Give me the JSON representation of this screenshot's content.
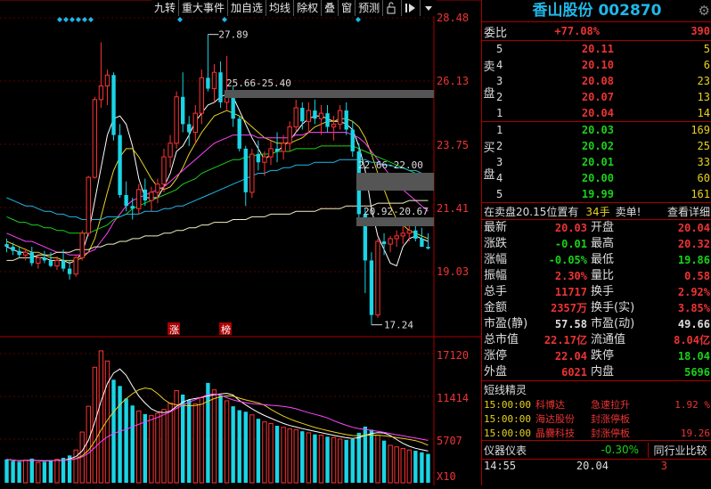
{
  "toolbar": [
    "九转",
    "重大事件",
    "加自选",
    "均线",
    "除权",
    "叠",
    "窗",
    "预测",
    "锁",
    "箭头",
    "下拉"
  ],
  "price_axis": [
    "28.48",
    "26.13",
    "23.75",
    "21.41",
    "19.03"
  ],
  "volume_axis": [
    "17120",
    "11414",
    "5707",
    "X10"
  ],
  "annotations": {
    "high": "27.89",
    "low": "17.24",
    "zone1": "25.66-25.40",
    "zone2": "22.66-22.00",
    "zone3": "20.92-20.67",
    "tag_zhang": "涨",
    "tag_bang": "榜"
  },
  "colors": {
    "up": "#ff3333",
    "down": "#19d5e6",
    "accent": "#1fb8e8",
    "volume_yellow": "#e8d21f",
    "green": "#19d219"
  },
  "chart_data": {
    "type": "candlestick",
    "ylim": [
      17.0,
      28.5
    ],
    "candles": [
      [
        20.2,
        20.4,
        19.9,
        20.1
      ],
      [
        20.1,
        20.25,
        19.8,
        19.95
      ],
      [
        19.95,
        20.1,
        19.7,
        19.8
      ],
      [
        19.8,
        20.05,
        19.6,
        19.9
      ],
      [
        19.9,
        20.1,
        19.4,
        19.5
      ],
      [
        19.5,
        19.8,
        19.3,
        19.7
      ],
      [
        19.7,
        19.95,
        19.5,
        19.6
      ],
      [
        19.6,
        19.9,
        19.35,
        19.4
      ],
      [
        19.4,
        19.75,
        19.25,
        19.6
      ],
      [
        19.6,
        20.0,
        19.2,
        19.3
      ],
      [
        19.3,
        19.6,
        18.9,
        19.1
      ],
      [
        19.1,
        19.8,
        19.0,
        19.7
      ],
      [
        19.7,
        20.7,
        19.6,
        20.6
      ],
      [
        20.6,
        22.7,
        20.5,
        22.65
      ],
      [
        22.65,
        25.6,
        22.6,
        25.5
      ],
      [
        25.5,
        27.6,
        25.2,
        26.0
      ],
      [
        26.0,
        26.6,
        25.3,
        26.4
      ],
      [
        26.4,
        26.5,
        24.0,
        24.2
      ],
      [
        24.2,
        24.6,
        21.9,
        22.0
      ],
      [
        22.0,
        22.5,
        21.4,
        21.6
      ],
      [
        21.6,
        21.9,
        21.1,
        21.5
      ],
      [
        21.5,
        22.4,
        21.3,
        22.2
      ],
      [
        22.2,
        22.6,
        21.6,
        21.8
      ],
      [
        21.8,
        22.3,
        21.4,
        22.1
      ],
      [
        22.1,
        22.6,
        21.7,
        22.4
      ],
      [
        22.4,
        23.7,
        22.1,
        23.4
      ],
      [
        23.4,
        24.2,
        23.0,
        23.9
      ],
      [
        23.9,
        25.8,
        23.7,
        25.6
      ],
      [
        25.6,
        26.5,
        24.3,
        24.6
      ],
      [
        24.6,
        24.9,
        23.8,
        24.3
      ],
      [
        24.3,
        25.3,
        23.9,
        25.0
      ],
      [
        25.0,
        26.6,
        24.6,
        26.3
      ],
      [
        26.3,
        27.89,
        25.8,
        25.9
      ],
      [
        25.9,
        26.8,
        25.4,
        26.5
      ],
      [
        26.5,
        26.9,
        25.2,
        25.4
      ],
      [
        25.4,
        27.1,
        25.1,
        25.8
      ],
      [
        25.8,
        26.0,
        24.5,
        24.8
      ],
      [
        24.8,
        24.9,
        23.6,
        23.7
      ],
      [
        23.7,
        23.8,
        21.6,
        22.1
      ],
      [
        22.1,
        23.7,
        21.9,
        23.5
      ],
      [
        23.5,
        24.0,
        22.9,
        23.2
      ],
      [
        23.2,
        23.6,
        22.7,
        23.4
      ],
      [
        23.4,
        24.0,
        23.1,
        23.7
      ],
      [
        23.7,
        24.3,
        23.2,
        23.6
      ],
      [
        23.6,
        24.2,
        23.3,
        23.9
      ],
      [
        23.9,
        24.7,
        23.6,
        24.5
      ],
      [
        24.5,
        25.5,
        24.3,
        25.2
      ],
      [
        25.2,
        25.4,
        24.4,
        24.7
      ],
      [
        24.7,
        25.4,
        24.3,
        25.1
      ],
      [
        25.1,
        25.5,
        24.6,
        24.8
      ],
      [
        24.8,
        25.3,
        24.2,
        25.0
      ],
      [
        25.0,
        25.3,
        24.3,
        24.5
      ],
      [
        24.5,
        24.9,
        24.0,
        24.6
      ],
      [
        24.6,
        25.3,
        24.4,
        25.1
      ],
      [
        25.1,
        25.4,
        24.2,
        24.4
      ],
      [
        24.4,
        24.7,
        23.4,
        23.6
      ],
      [
        23.6,
        23.9,
        21.1,
        21.3
      ],
      [
        21.3,
        21.5,
        18.4,
        19.6
      ],
      [
        19.6,
        19.9,
        17.24,
        17.6
      ],
      [
        17.6,
        20.4,
        17.5,
        20.3
      ],
      [
        20.3,
        20.6,
        19.8,
        20.2
      ],
      [
        20.2,
        20.5,
        19.9,
        20.4
      ],
      [
        20.4,
        20.7,
        20.1,
        20.5
      ],
      [
        20.5,
        20.9,
        20.2,
        20.6
      ],
      [
        20.6,
        20.9,
        20.3,
        20.7
      ],
      [
        20.7,
        20.92,
        20.3,
        20.4
      ],
      [
        20.4,
        20.8,
        20.2,
        20.1
      ],
      [
        20.1,
        20.6,
        20.0,
        20.04
      ]
    ],
    "volumes": [
      3000,
      2800,
      2700,
      2900,
      3100,
      2600,
      2700,
      2900,
      3000,
      3200,
      3500,
      4200,
      6500,
      9800,
      14800,
      16900,
      15600,
      13200,
      12400,
      10800,
      9900,
      9200,
      8800,
      8600,
      8900,
      9400,
      10200,
      11800,
      11300,
      10600,
      10100,
      10900,
      12800,
      11900,
      11200,
      10500,
      9800,
      9300,
      9100,
      8700,
      8200,
      7800,
      7600,
      7300,
      7100,
      6900,
      6800,
      6600,
      6400,
      6200,
      6100,
      5900,
      5800,
      5600,
      5500,
      5600,
      6400,
      7200,
      6800,
      6100,
      5400,
      4800,
      4600,
      4400,
      4200,
      4100,
      3900,
      3700
    ],
    "ma_series": [
      {
        "color": "#ffffff",
        "values": [
          20.1,
          20.0,
          19.9,
          19.9,
          19.8,
          19.7,
          19.7,
          19.6,
          19.6,
          19.6,
          19.5,
          19.6,
          19.9,
          20.6,
          21.8,
          23.0,
          24.2,
          24.8,
          24.9,
          24.6,
          23.8,
          22.6,
          21.9,
          21.9,
          21.9,
          22.3,
          22.8,
          23.6,
          23.8,
          24.2,
          24.7,
          25.0,
          25.3,
          25.4,
          25.6,
          25.7,
          25.6,
          25.1,
          24.6,
          24.1,
          23.7,
          23.3,
          23.5,
          23.6,
          23.8,
          24.0,
          24.3,
          24.6,
          24.8,
          24.9,
          24.9,
          24.8,
          24.7,
          24.7,
          24.6,
          24.4,
          23.8,
          22.9,
          21.5,
          20.5,
          20.0,
          19.5,
          19.4,
          20.1,
          20.4,
          20.5,
          20.4,
          20.3
        ]
      },
      {
        "color": "#e8d21f",
        "values": [
          20.3,
          20.2,
          20.1,
          20.0,
          19.9,
          19.9,
          19.8,
          19.7,
          19.7,
          19.6,
          19.6,
          19.6,
          19.7,
          19.9,
          20.4,
          21.2,
          22.1,
          22.9,
          23.4,
          23.7,
          23.7,
          23.4,
          23.0,
          22.6,
          22.3,
          22.2,
          22.3,
          22.6,
          23.0,
          23.5,
          23.9,
          24.3,
          24.6,
          24.9,
          25.0,
          25.1,
          25.0,
          24.9,
          24.7,
          24.5,
          24.3,
          24.1,
          24.0,
          23.9,
          23.9,
          23.9,
          24.0,
          24.1,
          24.3,
          24.5,
          24.6,
          24.7,
          24.7,
          24.8,
          24.8,
          24.7,
          24.5,
          24.1,
          23.5,
          22.8,
          22.2,
          21.6,
          21.1,
          20.9,
          20.7,
          20.6,
          20.5,
          20.4
        ]
      },
      {
        "color": "#ff44ff",
        "values": [
          20.6,
          20.5,
          20.4,
          20.3,
          20.3,
          20.2,
          20.1,
          20.0,
          19.9,
          19.9,
          19.8,
          19.8,
          19.8,
          19.9,
          20.0,
          20.3,
          20.6,
          21.0,
          21.3,
          21.6,
          21.8,
          21.9,
          22.0,
          22.1,
          22.2,
          22.3,
          22.5,
          22.7,
          22.9,
          23.1,
          23.3,
          23.5,
          23.7,
          23.9,
          24.0,
          24.1,
          24.2,
          24.2,
          24.2,
          24.2,
          24.1,
          24.1,
          24.1,
          24.1,
          24.1,
          24.1,
          24.2,
          24.2,
          24.3,
          24.3,
          24.3,
          24.3,
          24.3,
          24.3,
          24.3,
          24.2,
          24.1,
          23.9,
          23.6,
          23.3,
          23.0,
          22.7,
          22.4,
          22.2,
          22.0,
          21.8,
          21.6,
          21.4
        ]
      },
      {
        "color": "#19d219",
        "values": [
          21.2,
          21.1,
          21.0,
          21.0,
          20.9,
          20.9,
          20.8,
          20.8,
          20.7,
          20.7,
          20.6,
          20.6,
          20.6,
          20.6,
          20.7,
          20.8,
          20.9,
          21.1,
          21.2,
          21.3,
          21.5,
          21.6,
          21.7,
          21.8,
          21.9,
          22.0,
          22.1,
          22.2,
          22.4,
          22.5,
          22.6,
          22.8,
          22.9,
          23.0,
          23.1,
          23.2,
          23.3,
          23.3,
          23.4,
          23.4,
          23.5,
          23.5,
          23.5,
          23.6,
          23.6,
          23.6,
          23.7,
          23.7,
          23.7,
          23.7,
          23.8,
          23.8,
          23.8,
          23.8,
          23.8,
          23.8,
          23.7,
          23.6,
          23.5,
          23.4,
          23.3,
          23.2,
          23.1,
          23.0,
          22.9,
          22.8,
          22.7,
          22.6
        ]
      },
      {
        "color": "#1fb8e8",
        "values": [
          21.9,
          21.8,
          21.7,
          21.6,
          21.6,
          21.5,
          21.4,
          21.4,
          21.3,
          21.3,
          21.2,
          21.2,
          21.1,
          21.1,
          21.1,
          21.1,
          21.2,
          21.2,
          21.2,
          21.3,
          21.3,
          21.3,
          21.4,
          21.4,
          21.4,
          21.5,
          21.5,
          21.6,
          21.6,
          21.7,
          21.8,
          21.9,
          22.0,
          22.1,
          22.2,
          22.3,
          22.4,
          22.5,
          22.6,
          22.7,
          22.8,
          22.8,
          22.9,
          22.9,
          23.0,
          23.0,
          23.1,
          23.1,
          23.1,
          23.2,
          23.2,
          23.2,
          23.2,
          23.3,
          23.3,
          23.3,
          23.3,
          23.3,
          23.2,
          23.2,
          23.1,
          23.1,
          23.0,
          23.0,
          22.9,
          22.9,
          22.8,
          22.8
        ]
      },
      {
        "color": "#f0f0c0",
        "values": [
          19.6,
          19.6,
          19.7,
          19.7,
          19.7,
          19.8,
          19.8,
          19.8,
          19.9,
          19.9,
          19.9,
          20.0,
          20.0,
          20.0,
          20.1,
          20.1,
          20.2,
          20.2,
          20.3,
          20.3,
          20.4,
          20.4,
          20.5,
          20.5,
          20.5,
          20.6,
          20.6,
          20.7,
          20.7,
          20.8,
          20.8,
          20.9,
          20.9,
          21.0,
          21.0,
          21.0,
          21.1,
          21.1,
          21.1,
          21.2,
          21.2,
          21.2,
          21.3,
          21.3,
          21.3,
          21.3,
          21.4,
          21.4,
          21.4,
          21.4,
          21.5,
          21.5,
          21.5,
          21.5,
          21.6,
          21.6,
          21.6,
          21.6,
          21.6,
          21.7,
          21.7,
          21.7,
          21.7,
          21.7,
          21.8,
          21.8,
          21.8,
          21.8
        ]
      }
    ]
  },
  "panel": {
    "title": "香山股份 002870",
    "weibi_label": "委比",
    "weibi_value": "+77.08%",
    "weibi_diff": "390",
    "sell_label": [
      "卖",
      "盘"
    ],
    "buy_label": [
      "买",
      "盘"
    ],
    "sell": [
      [
        "5",
        "20.11",
        "5"
      ],
      [
        "4",
        "20.10",
        "6"
      ],
      [
        "3",
        "20.08",
        "23"
      ],
      [
        "2",
        "20.07",
        "13"
      ],
      [
        "1",
        "20.04",
        "14"
      ]
    ],
    "buy": [
      [
        "1",
        "20.03",
        "169"
      ],
      [
        "2",
        "20.02",
        "25"
      ],
      [
        "3",
        "20.01",
        "33"
      ],
      [
        "4",
        "20.00",
        "60"
      ],
      [
        "5",
        "19.99",
        "161"
      ]
    ],
    "info_text": "在卖盘20.15位置有",
    "info_qty": "34手",
    "info_sell": "卖单!",
    "info_detail": "查看详细",
    "stats": [
      [
        "最新",
        "20.03",
        "开盘",
        "20.04"
      ],
      [
        "涨跌",
        "-0.01",
        "最高",
        "20.32"
      ],
      [
        "涨幅",
        "-0.05%",
        "最低",
        "19.86"
      ],
      [
        "振幅",
        "2.30%",
        "量比",
        "0.58"
      ],
      [
        "总手",
        "11717",
        "换手",
        "2.92%"
      ],
      [
        "金额",
        "2357万",
        "换手(实)",
        "3.85%"
      ],
      [
        "市盈(静)",
        "57.58",
        "市盈(动)",
        "49.66"
      ],
      [
        "总市值",
        "22.17亿",
        "流通值",
        "8.04亿"
      ],
      [
        "涨停",
        "22.04",
        "跌停",
        "18.04"
      ],
      [
        "外盘",
        "6021",
        "内盘",
        "5696"
      ]
    ],
    "stat_colors": [
      [
        "#e33",
        "#e33"
      ],
      [
        "#19d219",
        "#e33"
      ],
      [
        "#19d219",
        "#19d219"
      ],
      [
        "#e33",
        "#e33"
      ],
      [
        "#e33",
        "#e33"
      ],
      [
        "#e33",
        "#e33"
      ],
      [
        "#ddd",
        "#ddd"
      ],
      [
        "#e33",
        "#e33"
      ],
      [
        "#e33",
        "#19d219"
      ],
      [
        "#e33",
        "#19d219"
      ]
    ],
    "news_title": "短线精灵",
    "news": [
      [
        "15:00:00",
        "科博达",
        "急速拉升",
        "1.92 %"
      ],
      [
        "15:00:00",
        "海达股份",
        "封涨停板",
        ""
      ],
      [
        "15:00:00",
        "晶爨科技",
        "封涨停板",
        "19.26"
      ]
    ],
    "bottom_label": "仪器仪表",
    "bottom_value": "-0.30%",
    "bottom_btn": "同行业比较",
    "tick_time": "14:55",
    "tick_price": "20.04",
    "tick_qty": "3"
  }
}
